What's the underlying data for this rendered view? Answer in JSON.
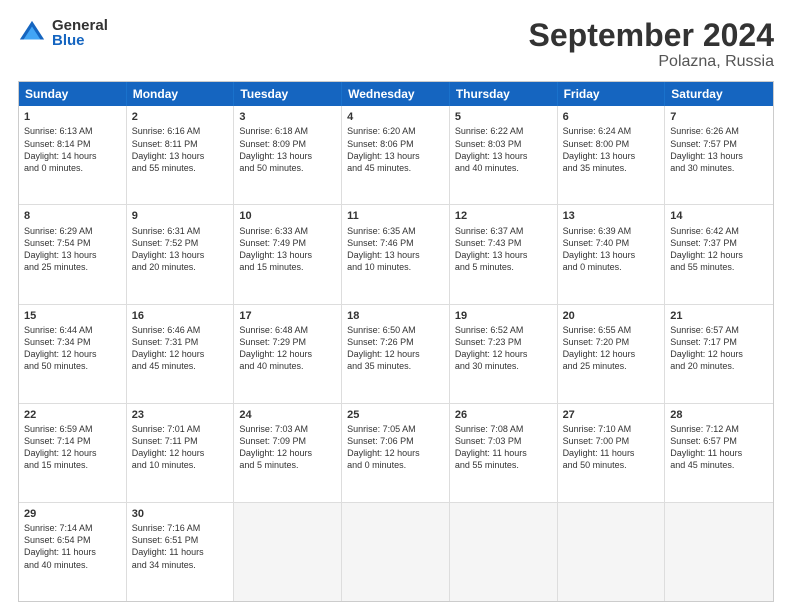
{
  "logo": {
    "general": "General",
    "blue": "Blue"
  },
  "title": "September 2024",
  "location": "Polazna, Russia",
  "headers": [
    "Sunday",
    "Monday",
    "Tuesday",
    "Wednesday",
    "Thursday",
    "Friday",
    "Saturday"
  ],
  "rows": [
    [
      {
        "day": "1",
        "lines": [
          "Sunrise: 6:13 AM",
          "Sunset: 8:14 PM",
          "Daylight: 14 hours",
          "and 0 minutes."
        ]
      },
      {
        "day": "2",
        "lines": [
          "Sunrise: 6:16 AM",
          "Sunset: 8:11 PM",
          "Daylight: 13 hours",
          "and 55 minutes."
        ]
      },
      {
        "day": "3",
        "lines": [
          "Sunrise: 6:18 AM",
          "Sunset: 8:09 PM",
          "Daylight: 13 hours",
          "and 50 minutes."
        ]
      },
      {
        "day": "4",
        "lines": [
          "Sunrise: 6:20 AM",
          "Sunset: 8:06 PM",
          "Daylight: 13 hours",
          "and 45 minutes."
        ]
      },
      {
        "day": "5",
        "lines": [
          "Sunrise: 6:22 AM",
          "Sunset: 8:03 PM",
          "Daylight: 13 hours",
          "and 40 minutes."
        ]
      },
      {
        "day": "6",
        "lines": [
          "Sunrise: 6:24 AM",
          "Sunset: 8:00 PM",
          "Daylight: 13 hours",
          "and 35 minutes."
        ]
      },
      {
        "day": "7",
        "lines": [
          "Sunrise: 6:26 AM",
          "Sunset: 7:57 PM",
          "Daylight: 13 hours",
          "and 30 minutes."
        ]
      }
    ],
    [
      {
        "day": "8",
        "lines": [
          "Sunrise: 6:29 AM",
          "Sunset: 7:54 PM",
          "Daylight: 13 hours",
          "and 25 minutes."
        ]
      },
      {
        "day": "9",
        "lines": [
          "Sunrise: 6:31 AM",
          "Sunset: 7:52 PM",
          "Daylight: 13 hours",
          "and 20 minutes."
        ]
      },
      {
        "day": "10",
        "lines": [
          "Sunrise: 6:33 AM",
          "Sunset: 7:49 PM",
          "Daylight: 13 hours",
          "and 15 minutes."
        ]
      },
      {
        "day": "11",
        "lines": [
          "Sunrise: 6:35 AM",
          "Sunset: 7:46 PM",
          "Daylight: 13 hours",
          "and 10 minutes."
        ]
      },
      {
        "day": "12",
        "lines": [
          "Sunrise: 6:37 AM",
          "Sunset: 7:43 PM",
          "Daylight: 13 hours",
          "and 5 minutes."
        ]
      },
      {
        "day": "13",
        "lines": [
          "Sunrise: 6:39 AM",
          "Sunset: 7:40 PM",
          "Daylight: 13 hours",
          "and 0 minutes."
        ]
      },
      {
        "day": "14",
        "lines": [
          "Sunrise: 6:42 AM",
          "Sunset: 7:37 PM",
          "Daylight: 12 hours",
          "and 55 minutes."
        ]
      }
    ],
    [
      {
        "day": "15",
        "lines": [
          "Sunrise: 6:44 AM",
          "Sunset: 7:34 PM",
          "Daylight: 12 hours",
          "and 50 minutes."
        ]
      },
      {
        "day": "16",
        "lines": [
          "Sunrise: 6:46 AM",
          "Sunset: 7:31 PM",
          "Daylight: 12 hours",
          "and 45 minutes."
        ]
      },
      {
        "day": "17",
        "lines": [
          "Sunrise: 6:48 AM",
          "Sunset: 7:29 PM",
          "Daylight: 12 hours",
          "and 40 minutes."
        ]
      },
      {
        "day": "18",
        "lines": [
          "Sunrise: 6:50 AM",
          "Sunset: 7:26 PM",
          "Daylight: 12 hours",
          "and 35 minutes."
        ]
      },
      {
        "day": "19",
        "lines": [
          "Sunrise: 6:52 AM",
          "Sunset: 7:23 PM",
          "Daylight: 12 hours",
          "and 30 minutes."
        ]
      },
      {
        "day": "20",
        "lines": [
          "Sunrise: 6:55 AM",
          "Sunset: 7:20 PM",
          "Daylight: 12 hours",
          "and 25 minutes."
        ]
      },
      {
        "day": "21",
        "lines": [
          "Sunrise: 6:57 AM",
          "Sunset: 7:17 PM",
          "Daylight: 12 hours",
          "and 20 minutes."
        ]
      }
    ],
    [
      {
        "day": "22",
        "lines": [
          "Sunrise: 6:59 AM",
          "Sunset: 7:14 PM",
          "Daylight: 12 hours",
          "and 15 minutes."
        ]
      },
      {
        "day": "23",
        "lines": [
          "Sunrise: 7:01 AM",
          "Sunset: 7:11 PM",
          "Daylight: 12 hours",
          "and 10 minutes."
        ]
      },
      {
        "day": "24",
        "lines": [
          "Sunrise: 7:03 AM",
          "Sunset: 7:09 PM",
          "Daylight: 12 hours",
          "and 5 minutes."
        ]
      },
      {
        "day": "25",
        "lines": [
          "Sunrise: 7:05 AM",
          "Sunset: 7:06 PM",
          "Daylight: 12 hours",
          "and 0 minutes."
        ]
      },
      {
        "day": "26",
        "lines": [
          "Sunrise: 7:08 AM",
          "Sunset: 7:03 PM",
          "Daylight: 11 hours",
          "and 55 minutes."
        ]
      },
      {
        "day": "27",
        "lines": [
          "Sunrise: 7:10 AM",
          "Sunset: 7:00 PM",
          "Daylight: 11 hours",
          "and 50 minutes."
        ]
      },
      {
        "day": "28",
        "lines": [
          "Sunrise: 7:12 AM",
          "Sunset: 6:57 PM",
          "Daylight: 11 hours",
          "and 45 minutes."
        ]
      }
    ],
    [
      {
        "day": "29",
        "lines": [
          "Sunrise: 7:14 AM",
          "Sunset: 6:54 PM",
          "Daylight: 11 hours",
          "and 40 minutes."
        ]
      },
      {
        "day": "30",
        "lines": [
          "Sunrise: 7:16 AM",
          "Sunset: 6:51 PM",
          "Daylight: 11 hours",
          "and 34 minutes."
        ]
      },
      {
        "day": "",
        "lines": []
      },
      {
        "day": "",
        "lines": []
      },
      {
        "day": "",
        "lines": []
      },
      {
        "day": "",
        "lines": []
      },
      {
        "day": "",
        "lines": []
      }
    ]
  ]
}
